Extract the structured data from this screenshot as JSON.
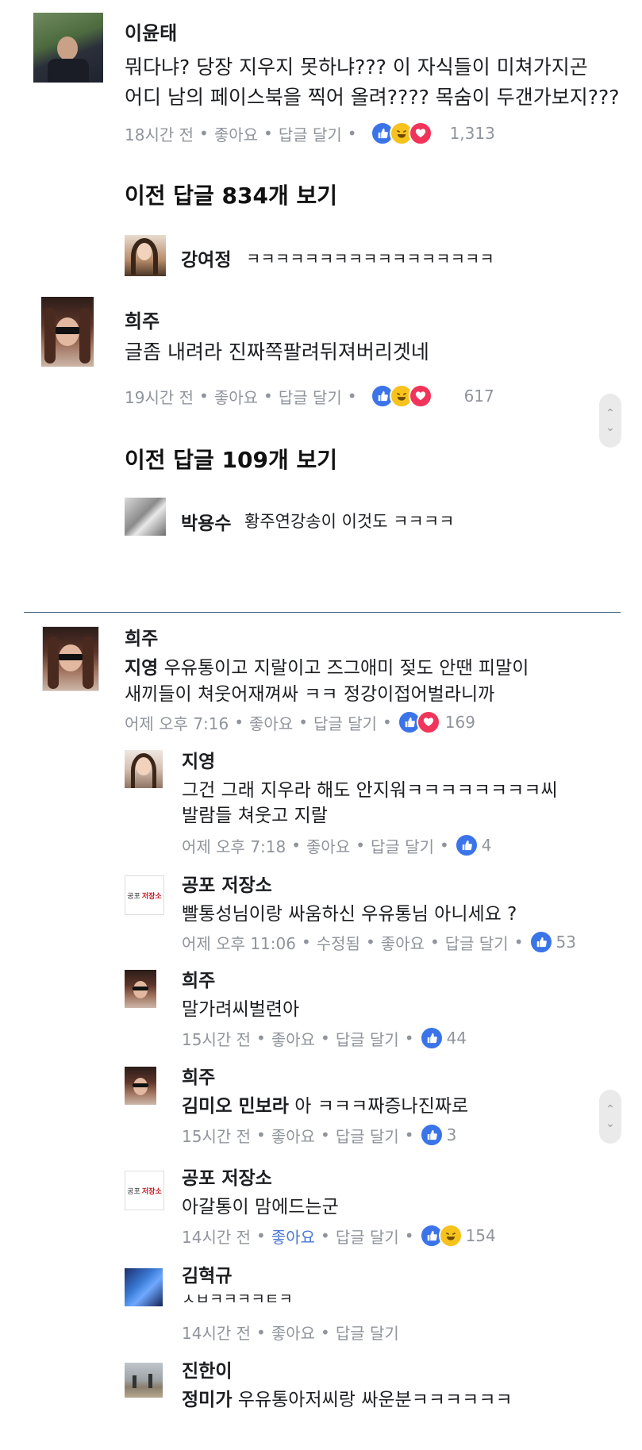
{
  "top_thread": {
    "comment1": {
      "author": "이윤태",
      "text_line1": "뭐다냐? 당장 지우지 못하냐??? 이 자식들이 미쳐가지곤",
      "text_line2": "어디 남의 페이스북을 찍어 올려???? 목숨이 두갠가보지???",
      "time": "18시간 전",
      "like": "좋아요",
      "reply": "답글 달기",
      "count": "1,313"
    },
    "prev_replies1": "이전 답글 834개 보기",
    "reply1": {
      "author": "강여정",
      "text": "ㅋㅋㅋㅋㅋㅋㅋㅋㅋㅋㅋㅋㅋㅋㅋㅋㅋ"
    },
    "comment2": {
      "author": "희주",
      "text": "글좀 내려라 진짜쪽팔려뒤져버리겟네",
      "time": "19시간 전",
      "like": "좋아요",
      "reply": "답글 달기",
      "count": "617"
    },
    "prev_replies2": "이전 답글 109개 보기",
    "reply2": {
      "author": "박용수",
      "text": "황주연강송이 이것도 ㅋㅋㅋㅋ"
    }
  },
  "bottom_thread": {
    "main": {
      "author": "희주",
      "tag": "지영",
      "text_line1": " 우유통이고 지랄이고 즈그애미 젖도 안땐 피말이",
      "text_line2": "새끼들이 쳐웃어재껴싸 ㅋㅋ 정강이접어벌라니까",
      "time": "어제 오후 7:16",
      "like": "좋아요",
      "reply": "답글 달기",
      "count": "169"
    },
    "replies": [
      {
        "author": "지영",
        "line1": "그건 그래 지우라 해도 안지워ㅋㅋㅋㅋㅋㅋㅋㅋ씨",
        "line2": "발람들 쳐웃고 지랄",
        "time": "어제 오후 7:18",
        "like": "좋아요",
        "reply": "답글 달기",
        "count": "4"
      },
      {
        "author": "공포 저장소",
        "line1": "빨통성님이랑 싸움하신 우유통님 아니세요 ?",
        "time": "어제 오후 11:06",
        "edited": "수정됨",
        "like": "좋아요",
        "reply": "답글 달기",
        "count": "53"
      },
      {
        "author": "희주",
        "line1": "말가려씨벌련아",
        "time": "15시간 전",
        "like": "좋아요",
        "reply": "답글 달기",
        "count": "44"
      },
      {
        "author": "희주",
        "tag": "김미오 민보라",
        "line1": " 아 ㅋㅋㅋ짜증나진짜로",
        "time": "15시간 전",
        "like": "좋아요",
        "reply": "답글 달기",
        "count": "3"
      },
      {
        "author": "공포 저장소",
        "line1": "아갈통이 맘에드는군",
        "time": "14시간 전",
        "like": "좋아요",
        "reply": "답글 달기",
        "count": "154"
      },
      {
        "author": "김혁규",
        "line1": "ㅅㅂㅋㅋㅋㅋㅌㅋ",
        "time": "14시간 전",
        "like": "좋아요",
        "reply": "답글 달기"
      },
      {
        "author": "진한이",
        "tag": "정미가",
        "line1": "  우유통아저씨랑 싸운분ㅋㅋㅋㅋㅋㅋ"
      }
    ]
  },
  "page_logo": {
    "left": "공포",
    "right": "저장소"
  },
  "colors": {
    "like": "#3b74e8",
    "love": "#f0345a",
    "haha": "#f7c21c",
    "meta": "#90949c",
    "liked_text": "#4a76d8"
  }
}
